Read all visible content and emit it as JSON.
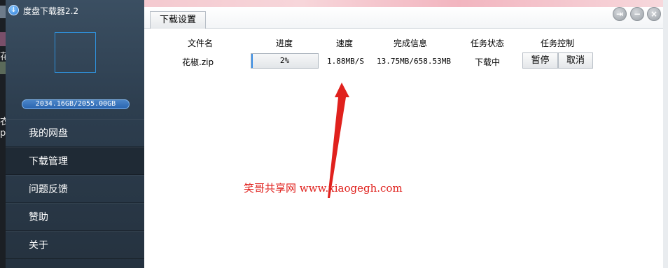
{
  "app": {
    "title": "度盘下载器2.2",
    "icon": "download-arrow-icon"
  },
  "desktop": {
    "left_text_1": "花",
    "left_text_2": "衣",
    "left_text_3": "p"
  },
  "account": {
    "quota": "2034.16GB/2055.00GB"
  },
  "sidebar": {
    "items": [
      {
        "label": "我的网盘"
      },
      {
        "label": "下载管理",
        "active": true
      },
      {
        "label": "问题反馈"
      },
      {
        "label": "赞助"
      },
      {
        "label": "关于"
      }
    ]
  },
  "toolbar": {
    "settings_label": "下载设置"
  },
  "window_controls": {
    "restore_icon": "⇥",
    "minimize_icon": "−",
    "close_icon": "×"
  },
  "downloads": {
    "columns": [
      "文件名",
      "进度",
      "速度",
      "完成信息",
      "任务状态",
      "任务控制"
    ],
    "rows": [
      {
        "filename": "花椒.zip",
        "progress_label": "2%",
        "progress_fraction": 0.02,
        "speed": "1.88MB/S",
        "completed": "13.75MB/658.53MB",
        "status": "下载中",
        "pause_label": "暂停",
        "cancel_label": "取消"
      }
    ]
  },
  "watermark": {
    "text": "笑哥共享网 www.xiaogegh.com",
    "color": "#e0211d"
  },
  "colors": {
    "accent": "#2a65b0",
    "arrow": "#e0211d"
  }
}
